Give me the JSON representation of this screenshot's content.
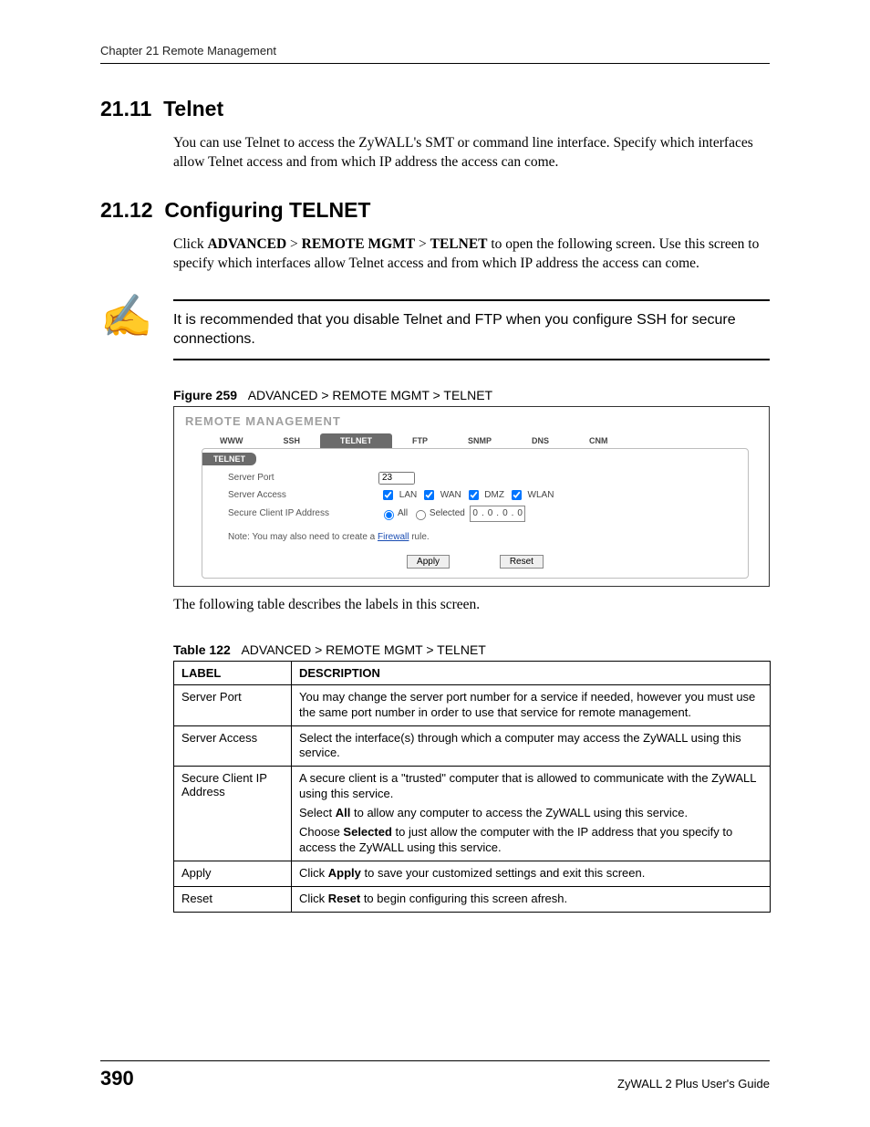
{
  "running_head": "Chapter 21 Remote Management",
  "sec1": {
    "num": "21.11",
    "title": "Telnet",
    "para": "You can use Telnet to access the ZyWALL's SMT or command line interface. Specify which interfaces allow Telnet access and from which IP address the access can come."
  },
  "sec2": {
    "num": "21.12",
    "title": "Configuring TELNET",
    "para_pre": "Click ",
    "path_a": "ADVANCED",
    "gt1": " > ",
    "path_b": "REMOTE MGMT",
    "gt2": " > ",
    "path_c": "TELNET",
    "para_post": " to open the following screen. Use this screen to specify which interfaces allow Telnet access and from which IP address the access can come."
  },
  "note": "It is recommended that you disable Telnet and FTP when you configure SSH for secure connections.",
  "figure": {
    "label": "Figure 259",
    "caption": "ADVANCED > REMOTE MGMT > TELNET"
  },
  "ui": {
    "title": "REMOTE MANAGEMENT",
    "tabs": [
      "WWW",
      "SSH",
      "TELNET",
      "FTP",
      "SNMP",
      "DNS",
      "CNM"
    ],
    "active_tab": "TELNET",
    "section": "TELNET",
    "rows": {
      "server_port_label": "Server Port",
      "server_port_value": "23",
      "server_access_label": "Server Access",
      "access_opts": [
        "LAN",
        "WAN",
        "DMZ",
        "WLAN"
      ],
      "secure_ip_label": "Secure Client IP Address",
      "radio_all": "All",
      "radio_selected": "Selected",
      "ip": [
        "0",
        "0",
        "0",
        "0"
      ]
    },
    "note_pre": "Note: You may also need to create a ",
    "note_link": "Firewall",
    "note_post": " rule.",
    "apply": "Apply",
    "reset": "Reset"
  },
  "post_figure_para": "The following table describes the labels in this screen.",
  "table_caption": {
    "label": "Table 122",
    "caption": "ADVANCED > REMOTE MGMT > TELNET"
  },
  "table": {
    "head_label": "LABEL",
    "head_desc": "DESCRIPTION",
    "rows": [
      {
        "label": "Server Port",
        "desc": [
          "You may change the server port number for a service if needed, however you must use the same port number in order to use that service for remote management."
        ]
      },
      {
        "label": "Server Access",
        "desc": [
          "Select the interface(s) through which a computer may access the ZyWALL using this service."
        ]
      },
      {
        "label": "Secure Client IP Address",
        "desc": [
          "A secure client is a \"trusted\" computer that is allowed to communicate with the ZyWALL using this service.",
          {
            "pre": "Select ",
            "b": "All",
            "post": " to allow any computer to access the ZyWALL using this service."
          },
          {
            "pre": "Choose ",
            "b": "Selected",
            "post": " to just allow the computer with the IP address that you specify to access the ZyWALL using this service."
          }
        ]
      },
      {
        "label": "Apply",
        "desc": [
          {
            "pre": "Click ",
            "b": "Apply",
            "post": " to save your customized settings and exit this screen."
          }
        ]
      },
      {
        "label": "Reset",
        "desc": [
          {
            "pre": "Click ",
            "b": "Reset",
            "post": " to begin configuring this screen afresh."
          }
        ]
      }
    ]
  },
  "footer": {
    "page": "390",
    "guide": "ZyWALL 2 Plus User's Guide"
  }
}
